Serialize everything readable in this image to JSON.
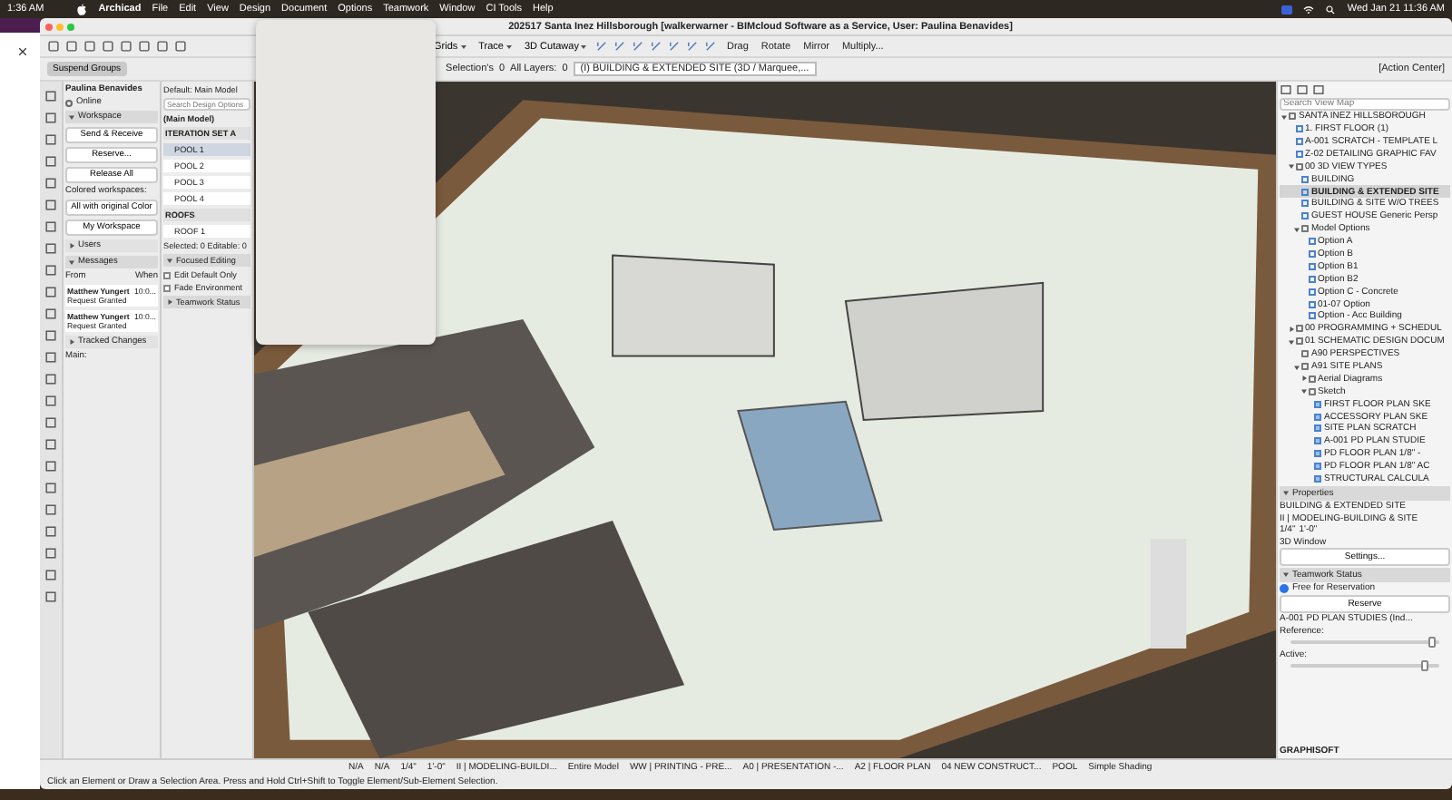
{
  "menu_bar": {
    "clock_left": "1:36 AM",
    "app_name": "Archicad",
    "items": [
      "File",
      "Edit",
      "View",
      "Design",
      "Document",
      "Options",
      "Teamwork",
      "Window",
      "CI Tools",
      "Help"
    ],
    "date_time": "Wed Jan 21  11:36 AM"
  },
  "window": {
    "title": "202517 Santa Inez Hillsborough [walkerwarner - BIMcloud Software as a Service, User: Paulina Benavides]"
  },
  "toolbar": {
    "left_items": [
      "Grids",
      "Trace",
      "3D Cutaway"
    ],
    "edit_items": [
      "Drag",
      "Rotate",
      "Mirror",
      "Multiply..."
    ]
  },
  "info_box": {
    "suspend_groups": "Suspend Groups",
    "selection_label": "Selection's",
    "selection_count": "0",
    "layers_label": "All Layers:",
    "layers_count": "0",
    "view": "(I) BUILDING & EXTENDED SITE  (3D / Marquee,...",
    "action_center": "[Action Center]"
  },
  "teamwork": {
    "user": "Paulina Benavides",
    "status": "Online",
    "sections": [
      {
        "kind": "workspace",
        "title": "Workspace",
        "expanded": true,
        "buttons": [
          "Send & Receive",
          "Reserve...",
          "Release All"
        ],
        "colored_label": "Colored workspaces:",
        "color_mode": "All with original Color",
        "my_workspace": "My Workspace"
      },
      {
        "kind": "plain",
        "title": "Users",
        "expanded": false
      },
      {
        "kind": "messages",
        "title": "Messages",
        "expanded": true,
        "col_from": "From",
        "col_when": "When",
        "messages": [
          {
            "sender": "Matthew Yungert",
            "time": "10:0...",
            "text": "Request Granted"
          },
          {
            "sender": "Matthew Yungert",
            "time": "10:0...",
            "text": "Request Granted"
          }
        ]
      },
      {
        "kind": "plain",
        "title": "Tracked Changes",
        "expanded": false
      }
    ],
    "main_label": "Main:"
  },
  "design_options": {
    "default": "Default: Main Model",
    "search": {
      "placeholder": "Search Design Options"
    },
    "main_model": "(Main Model)",
    "sets": [
      {
        "name": "ITERATION SET A",
        "options": [
          {
            "name": "POOL 1",
            "selected": true
          },
          {
            "name": "POOL 2",
            "selected": false
          },
          {
            "name": "POOL 3",
            "selected": false
          },
          {
            "name": "POOL 4",
            "selected": false
          }
        ]
      },
      {
        "name": "ROOFS",
        "options": [
          {
            "name": "ROOF 1",
            "selected": false
          }
        ]
      }
    ],
    "selected_info": "Selected: 0 Editable: 0",
    "focused_editing": {
      "title": "Focused Editing",
      "expanded": true,
      "checks": [
        {
          "label": "Edit Default Only",
          "checked": false
        },
        {
          "label": "Fade Environment",
          "checked": false
        }
      ]
    },
    "teamwork_status": {
      "title": "Teamwork Status",
      "expanded": false
    }
  },
  "navigator": {
    "search": {
      "placeholder": "Search View Map"
    },
    "tree": [
      {
        "name": "SANTA INEZ HILLSBOROUGH",
        "kind": "project",
        "selected": false,
        "expanded": true,
        "children": [
          {
            "name": "1. FIRST FLOOR (1)",
            "kind": "view",
            "selected": false
          },
          {
            "name": "A-001 SCRATCH - TEMPLATE L",
            "kind": "view",
            "selected": false
          },
          {
            "name": "Z-02 DETAILING GRAPHIC FAV",
            "kind": "view",
            "selected": false
          },
          {
            "name": "00 3D VIEW TYPES",
            "kind": "folder",
            "selected": false,
            "expanded": true,
            "children": [
              {
                "name": "BUILDING",
                "kind": "view",
                "selected": false
              },
              {
                "name": "BUILDING & EXTENDED SITE",
                "kind": "view",
                "selected": true
              },
              {
                "name": "BUILDING & SITE W/O TREES",
                "kind": "view",
                "selected": false
              },
              {
                "name": "GUEST HOUSE Generic Persp",
                "kind": "view",
                "selected": false
              },
              {
                "name": "Model Options",
                "kind": "folder",
                "selected": false,
                "expanded": true,
                "children": [
                  {
                    "name": "Option A",
                    "kind": "view",
                    "selected": false
                  },
                  {
                    "name": "Option B",
                    "kind": "view",
                    "selected": false
                  },
                  {
                    "name": "Option B1",
                    "kind": "view",
                    "selected": false
                  },
                  {
                    "name": "Option B2",
                    "kind": "view",
                    "selected": false
                  },
                  {
                    "name": "Option C - Concrete",
                    "kind": "view",
                    "selected": false
                  },
                  {
                    "name": "01-07 Option",
                    "kind": "view",
                    "selected": false
                  },
                  {
                    "name": "Option - Acc Building",
                    "kind": "view",
                    "selected": false
                  }
                ]
              }
            ]
          },
          {
            "name": "00 PROGRAMMING + SCHEDUL",
            "kind": "folder",
            "selected": false,
            "expanded": false
          },
          {
            "name": "01 SCHEMATIC DESIGN DOCUM",
            "kind": "folder",
            "selected": false,
            "expanded": true,
            "children": [
              {
                "name": "A90 PERSPECTIVES",
                "kind": "folder",
                "selected": false
              },
              {
                "name": "A91 SITE PLANS",
                "kind": "folder",
                "selected": false,
                "expanded": true,
                "children": [
                  {
                    "name": "Aerial Diagrams",
                    "kind": "folder",
                    "selected": false,
                    "expanded": false
                  },
                  {
                    "name": "Sketch",
                    "kind": "folder",
                    "selected": false,
                    "expanded": true,
                    "children": [
                      {
                        "name": "FIRST FLOOR PLAN SKE",
                        "kind": "plan",
                        "selected": false
                      },
                      {
                        "name": "ACCESSORY PLAN SKE",
                        "kind": "plan",
                        "selected": false
                      },
                      {
                        "name": "SITE PLAN SCRATCH",
                        "kind": "plan",
                        "selected": false
                      },
                      {
                        "name": "A-001 PD PLAN STUDIE",
                        "kind": "plan",
                        "selected": false
                      },
                      {
                        "name": "PD FLOOR PLAN 1/8\" -",
                        "kind": "plan",
                        "selected": false
                      },
                      {
                        "name": "PD FLOOR PLAN 1/8\" AC",
                        "kind": "plan",
                        "selected": false
                      },
                      {
                        "name": "STRUCTURAL CALCULA",
                        "kind": "plan",
                        "selected": false
                      }
                    ]
                  }
                ]
              }
            ]
          }
        ]
      }
    ]
  },
  "properties": {
    "title": "Properties",
    "view_name": "BUILDING & EXTENDED SITE",
    "layer_combo": "II | MODELING-BUILDING & SITE",
    "scale": "1/4\"",
    "scale_value": "1'-0\"",
    "window_kind": "3D Window",
    "settings_button": "Settings..."
  },
  "teamwork_status": {
    "title": "Teamwork Status",
    "status": "Free for Reservation",
    "reserve_button": "Reserve",
    "view_ref": "A-001 PD PLAN STUDIES (Ind...",
    "reference_label": "Reference:",
    "reference_slider": {
      "level": 0.95
    },
    "active_label": "Active:",
    "active_slider": {
      "level": 0.9
    },
    "brand": "GRAPHISOFT"
  },
  "quick_options": [
    "N/A",
    "N/A",
    "1/4\"",
    "1'-0\"",
    "II | MODELING-BUILDI...",
    "Entire Model",
    "WW | PRINTING - PRE...",
    "A0 | PRESENTATION -...",
    "A2 | FLOOR PLAN",
    "04 NEW CONSTRUCT...",
    "POOL",
    "Simple Shading"
  ],
  "status_bar": "Click an Element or Draw a Selection Area. Press and Hold Ctrl+Shift to Toggle Element/Sub-Element Selection."
}
